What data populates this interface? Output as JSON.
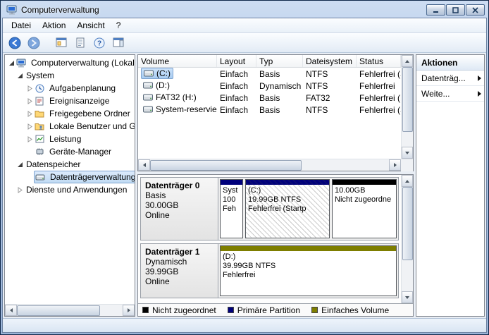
{
  "window": {
    "title": "Computerverwaltung"
  },
  "menu": {
    "items": [
      "Datei",
      "Aktion",
      "Ansicht",
      "?"
    ]
  },
  "tree": {
    "items": [
      {
        "label": "Computerverwaltung (Lokal)"
      },
      {
        "label": "System"
      },
      {
        "label": "Aufgabenplanung"
      },
      {
        "label": "Ereignisanzeige"
      },
      {
        "label": "Freigegebene Ordner"
      },
      {
        "label": "Lokale Benutzer und Grup"
      },
      {
        "label": "Leistung"
      },
      {
        "label": "Geräte-Manager"
      },
      {
        "label": "Datenspeicher"
      },
      {
        "label": "Datenträgerverwaltung"
      },
      {
        "label": "Dienste und Anwendungen"
      }
    ]
  },
  "volumes": {
    "columns": [
      "Volume",
      "Layout",
      "Typ",
      "Dateisystem",
      "Status"
    ],
    "rows": [
      {
        "volume": "(C:)",
        "layout": "Einfach",
        "typ": "Basis",
        "dateisystem": "NTFS",
        "status": "Fehlerfrei (St"
      },
      {
        "volume": "(D:)",
        "layout": "Einfach",
        "typ": "Dynamisch",
        "dateisystem": "NTFS",
        "status": "Fehlerfrei"
      },
      {
        "volume": "FAT32 (H:)",
        "layout": "Einfach",
        "typ": "Basis",
        "dateisystem": "FAT32",
        "status": "Fehlerfrei (Pr"
      },
      {
        "volume": "System-reserviert",
        "layout": "Einfach",
        "typ": "Basis",
        "dateisystem": "NTFS",
        "status": "Fehlerfrei (Sy"
      }
    ]
  },
  "disks": [
    {
      "name": "Datenträger 0",
      "kind": "Basis",
      "size": "30.00GB",
      "status": "Online",
      "partitions": [
        {
          "l1": "Syst",
          "l2": "100",
          "l3": "Feh"
        },
        {
          "l1": "(C:)",
          "l2": "19.99GB NTFS",
          "l3": "Fehlerfrei (Startp"
        },
        {
          "l1": "10.00GB",
          "l2": "Nicht zugeordne",
          "l3": ""
        }
      ]
    },
    {
      "name": "Datenträger 1",
      "kind": "Dynamisch",
      "size": "39.99GB",
      "status": "Online",
      "partitions": [
        {
          "l1": "(D:)",
          "l2": "39.99GB NTFS",
          "l3": "Fehlerfrei"
        }
      ]
    }
  ],
  "colors": {
    "unallocated": "#000000",
    "primary": "#00007b",
    "simple": "#7e7e00",
    "selection": "#c1dbf3"
  },
  "legend": [
    {
      "label": "Nicht zugeordnet",
      "color": "#000000"
    },
    {
      "label": "Primäre Partition",
      "color": "#00007b"
    },
    {
      "label": "Einfaches Volume",
      "color": "#7e7e00"
    }
  ],
  "actions": {
    "title": "Aktionen",
    "groups": [
      {
        "label": "Datenträg..."
      },
      {
        "label": "Weite..."
      }
    ]
  }
}
